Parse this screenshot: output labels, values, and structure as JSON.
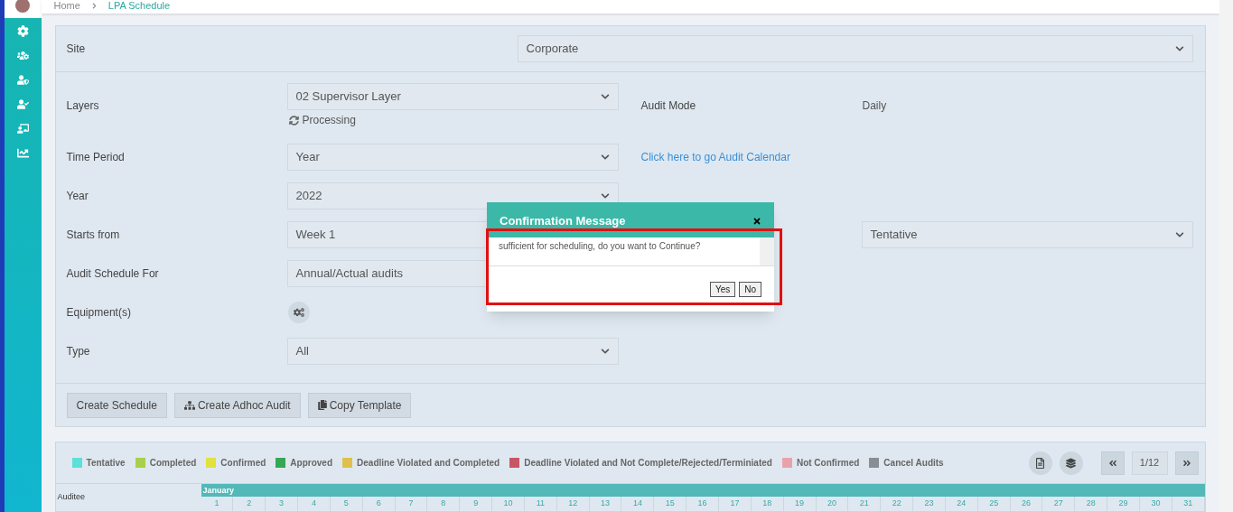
{
  "breadcrumb": [
    "Home",
    "LPA Schedule"
  ],
  "site": {
    "label": "Site",
    "value": "Corporate"
  },
  "form_left": [
    {
      "kind": "select",
      "label": "Layers",
      "value": "02 Supervisor Layer",
      "note": "Processing"
    },
    {
      "kind": "select",
      "label": "Time Period",
      "value": "Year"
    },
    {
      "kind": "select",
      "label": "Year",
      "value": "2022"
    },
    {
      "kind": "select",
      "label": "Starts from",
      "value": "Week 1"
    },
    {
      "kind": "select",
      "label": "Audit Schedule For",
      "value": "Annual/Actual audits"
    },
    {
      "kind": "icon",
      "label": "Equipment(s)"
    },
    {
      "kind": "select",
      "label": "Type",
      "value": "All"
    }
  ],
  "audit_mode": {
    "label": "Audit Mode",
    "value": "Daily"
  },
  "calendar_link": "Click here to go Audit Calendar",
  "status_select": {
    "value": "Tentative"
  },
  "buttons": [
    {
      "label": "Create Schedule"
    },
    {
      "label": "Create Adhoc Audit"
    },
    {
      "label": "Copy Template"
    }
  ],
  "legend": [
    {
      "label": "Tentative",
      "color": "#5ce0d8"
    },
    {
      "label": "Completed",
      "color": "#a8d04c"
    },
    {
      "label": "Confirmed",
      "color": "#e2e23e"
    },
    {
      "label": "Approved",
      "color": "#34a853"
    },
    {
      "label": "Deadline Violated and Completed",
      "color": "#e0c04c"
    },
    {
      "label": "Deadline Violated and Not Complete/Rejected/Terminiated",
      "color": "#c85565"
    },
    {
      "label": "Not Confirmed",
      "color": "#e8a2aa"
    },
    {
      "label": "Cancel Audits",
      "color": "#888e94"
    }
  ],
  "pager": {
    "page": "1/12"
  },
  "calendar": {
    "auditee_header": "Auditee",
    "month": "January",
    "days": [
      "1",
      "2",
      "3",
      "4",
      "5",
      "6",
      "7",
      "8",
      "9",
      "10",
      "11",
      "12",
      "13",
      "14",
      "15",
      "16",
      "17",
      "18",
      "19",
      "20",
      "21",
      "22",
      "23",
      "24",
      "25",
      "26",
      "27",
      "28",
      "29",
      "30",
      "31"
    ]
  },
  "dialog": {
    "title": "Confirmation Message",
    "message": "sufficient for scheduling, do you want to Continue?",
    "buttons": [
      "Yes",
      "No"
    ]
  }
}
